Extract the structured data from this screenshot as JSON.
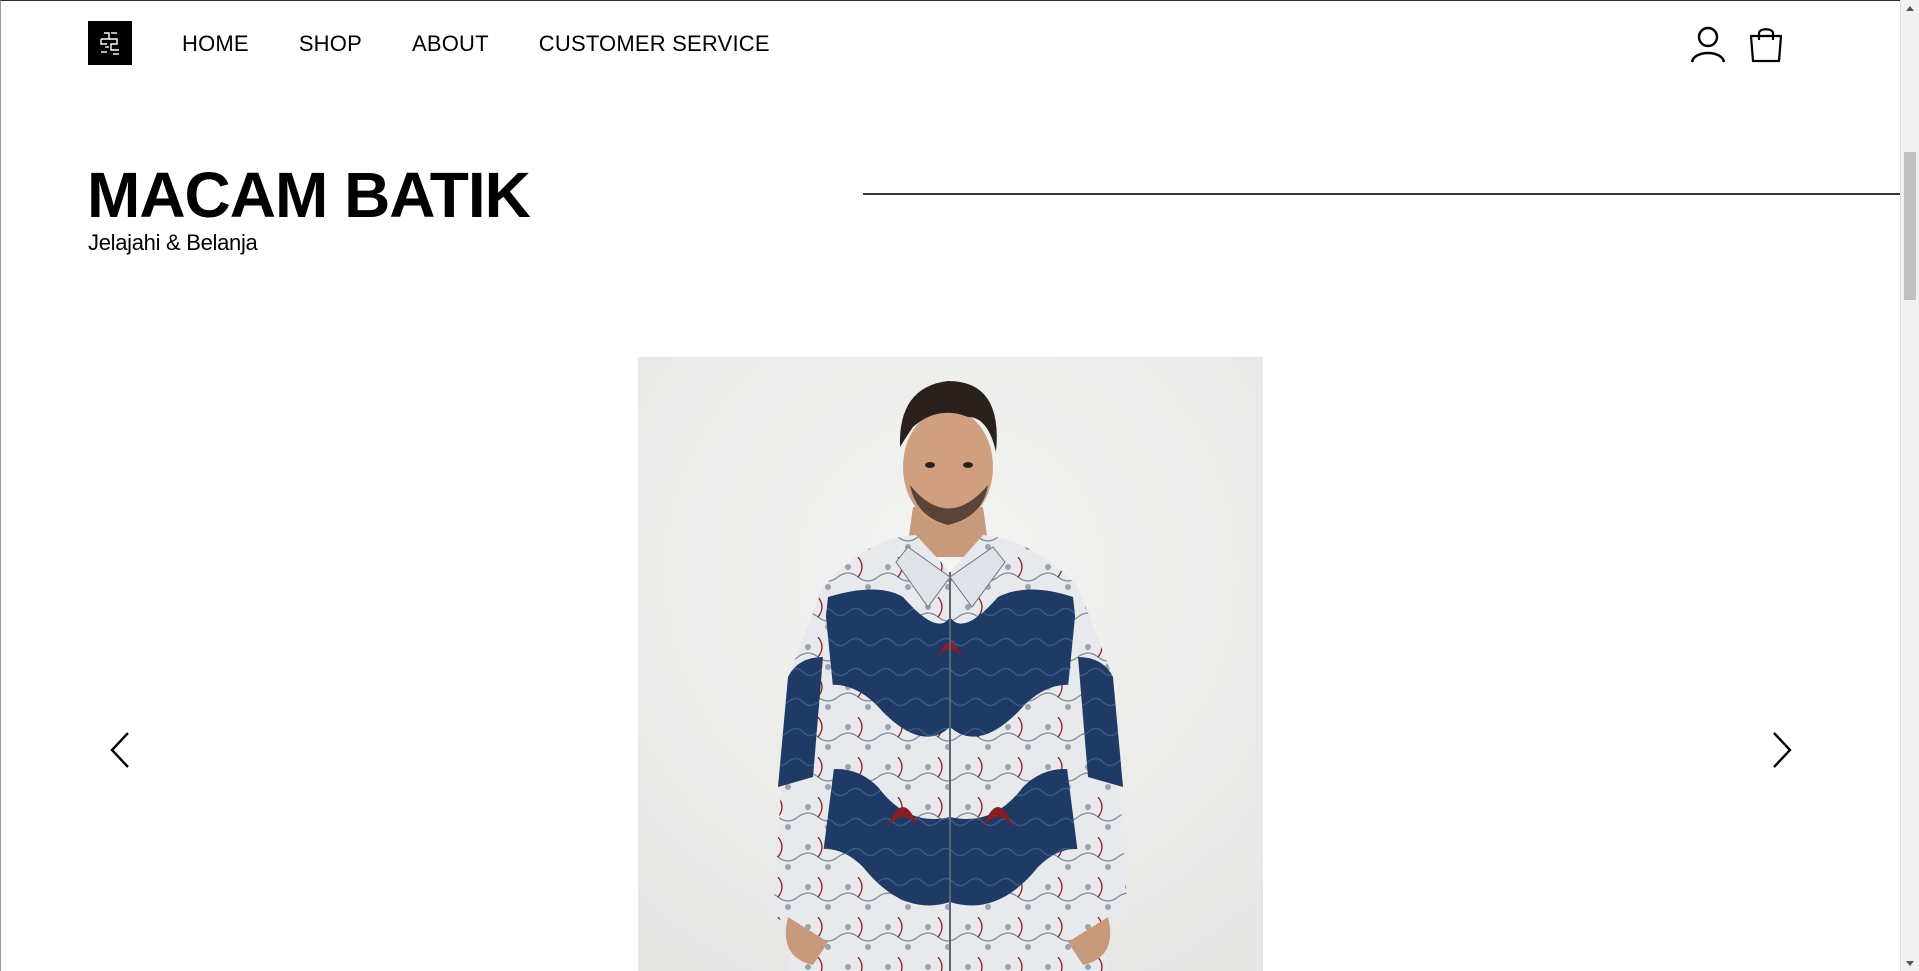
{
  "header": {
    "logo_name": "store-logo",
    "nav": [
      {
        "label": "HOME"
      },
      {
        "label": "SHOP"
      },
      {
        "label": "ABOUT"
      },
      {
        "label": "CUSTOMER SERVICE"
      }
    ],
    "icons": [
      "account-icon",
      "shopping-bag-icon"
    ]
  },
  "hero": {
    "title": "MACAM BATIK",
    "subtitle": "Jelajahi & Belanja"
  },
  "carousel": {
    "prev_icon": "chevron-left-icon",
    "next_icon": "chevron-right-icon",
    "image_subject": "man-in-batik-shirt"
  },
  "colors": {
    "text": "#000000",
    "background": "#ffffff",
    "batik_navy": "#1f3a64",
    "batik_red": "#8a1c24",
    "image_bg": "#efefee"
  }
}
